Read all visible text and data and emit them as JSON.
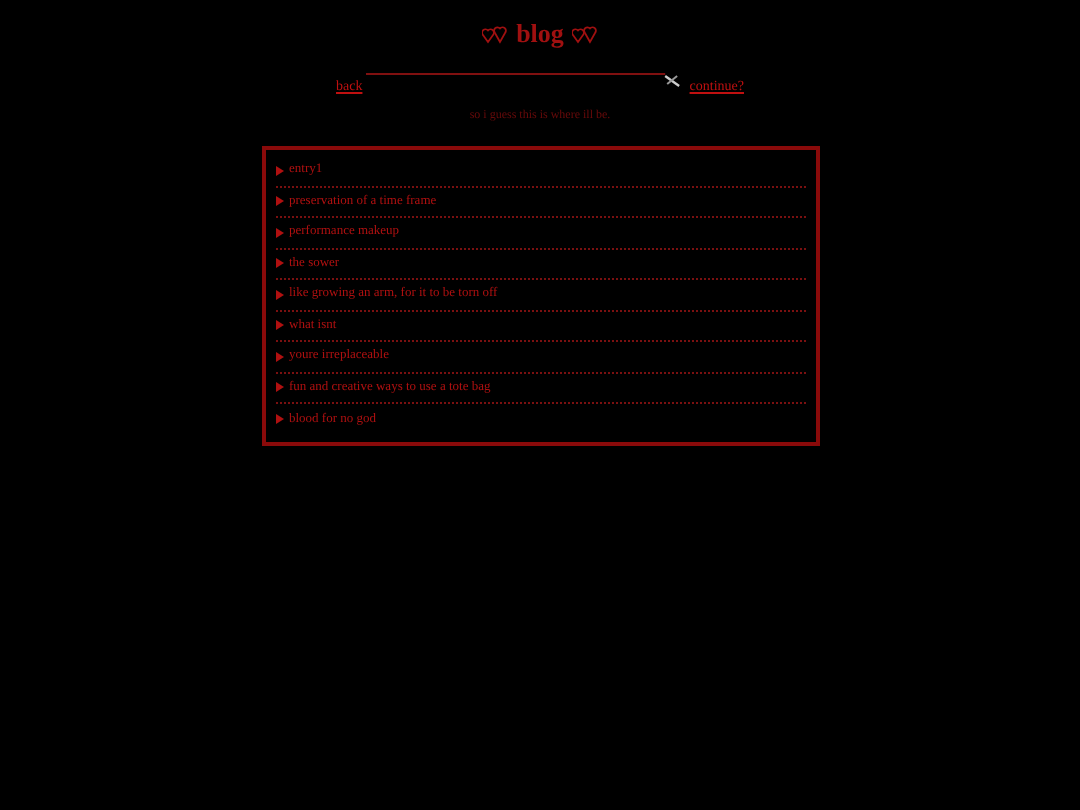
{
  "title": "blog",
  "nav": {
    "back": "back",
    "continue": "continue?"
  },
  "subtitle": "so i guess this is where ill be.",
  "entries": [
    {
      "title": "entry1"
    },
    {
      "title": "preservation of a time frame"
    },
    {
      "title": "performance makeup"
    },
    {
      "title": "the sower"
    },
    {
      "title": "like growing an arm, for it to be torn off"
    },
    {
      "title": "what isnt"
    },
    {
      "title": "youre irreplaceable"
    },
    {
      "title": "fun and creative ways to use a tote bag"
    },
    {
      "title": "blood for no god"
    }
  ]
}
